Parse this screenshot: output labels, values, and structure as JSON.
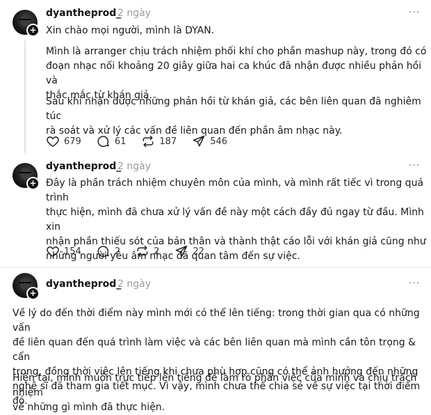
{
  "posts": [
    {
      "username": "dyantheprod_",
      "time": "2 ngày",
      "paragraphs": [
        "Xin chào mọi người, mình là DYAN.",
        "Mình là arranger chịu trách nhiệm phối khí cho phần mashup này, trong đó có\nđoạn nhạc nối khoảng 20 giây giữa hai ca khúc đã nhận được nhiều phản hồi và\nthắc mắc từ khán giả.",
        "Sau khi nhận được những phản hồi từ khán giả, các bên liên quan đã nghiêm túc\nrà soát và xử lý các vấn đề liên quan đến phần âm nhạc này."
      ],
      "actions": {
        "likes": "679",
        "replies": "61",
        "reposts": "187",
        "shares": "546"
      }
    },
    {
      "username": "dyantheprod_",
      "time": "2 ngày",
      "paragraphs": [
        "Đây là phần trách nhiệm chuyên môn của mình, và mình rất tiếc vì trong quá trình\nthực hiện, mình đã chưa xử lý vấn đề này một cách đầy đủ ngay từ đầu. Mình xin\nnhận phần thiếu sót của bản thân và thành thật cáo lỗi với khán giả cũng như\nnhững người yêu âm nhạc đã quan tâm đến sự việc."
      ],
      "actions": {
        "likes": "154",
        "replies": "2",
        "reposts": "2",
        "shares": "22"
      }
    },
    {
      "username": "dyantheprod_",
      "time": "2 ngày",
      "paragraphs": [
        "Về lý do đến thời điểm này mình mới có thể lên tiếng: trong thời gian qua có những vấn\nđề liên quan đến quá trình làm việc và các bên liên quan mà mình cần tôn trọng & cẩn\ntrọng, đồng thời việc lên tiếng khi chưa phù hợp cũng có thể ảnh hưởng đến những\nnghệ sĩ đã tham gia tiết mục. Vì vậy, mình chưa thể chia sẻ về sự việc tại thời điểm đó.",
        "Hiện tại, mình muốn trực tiếp lên tiếng để làm rõ phần việc của mình và chịu trách nhiệm\nvề những gì mình đã thực hiện."
      ]
    }
  ],
  "more_glyph": "···"
}
